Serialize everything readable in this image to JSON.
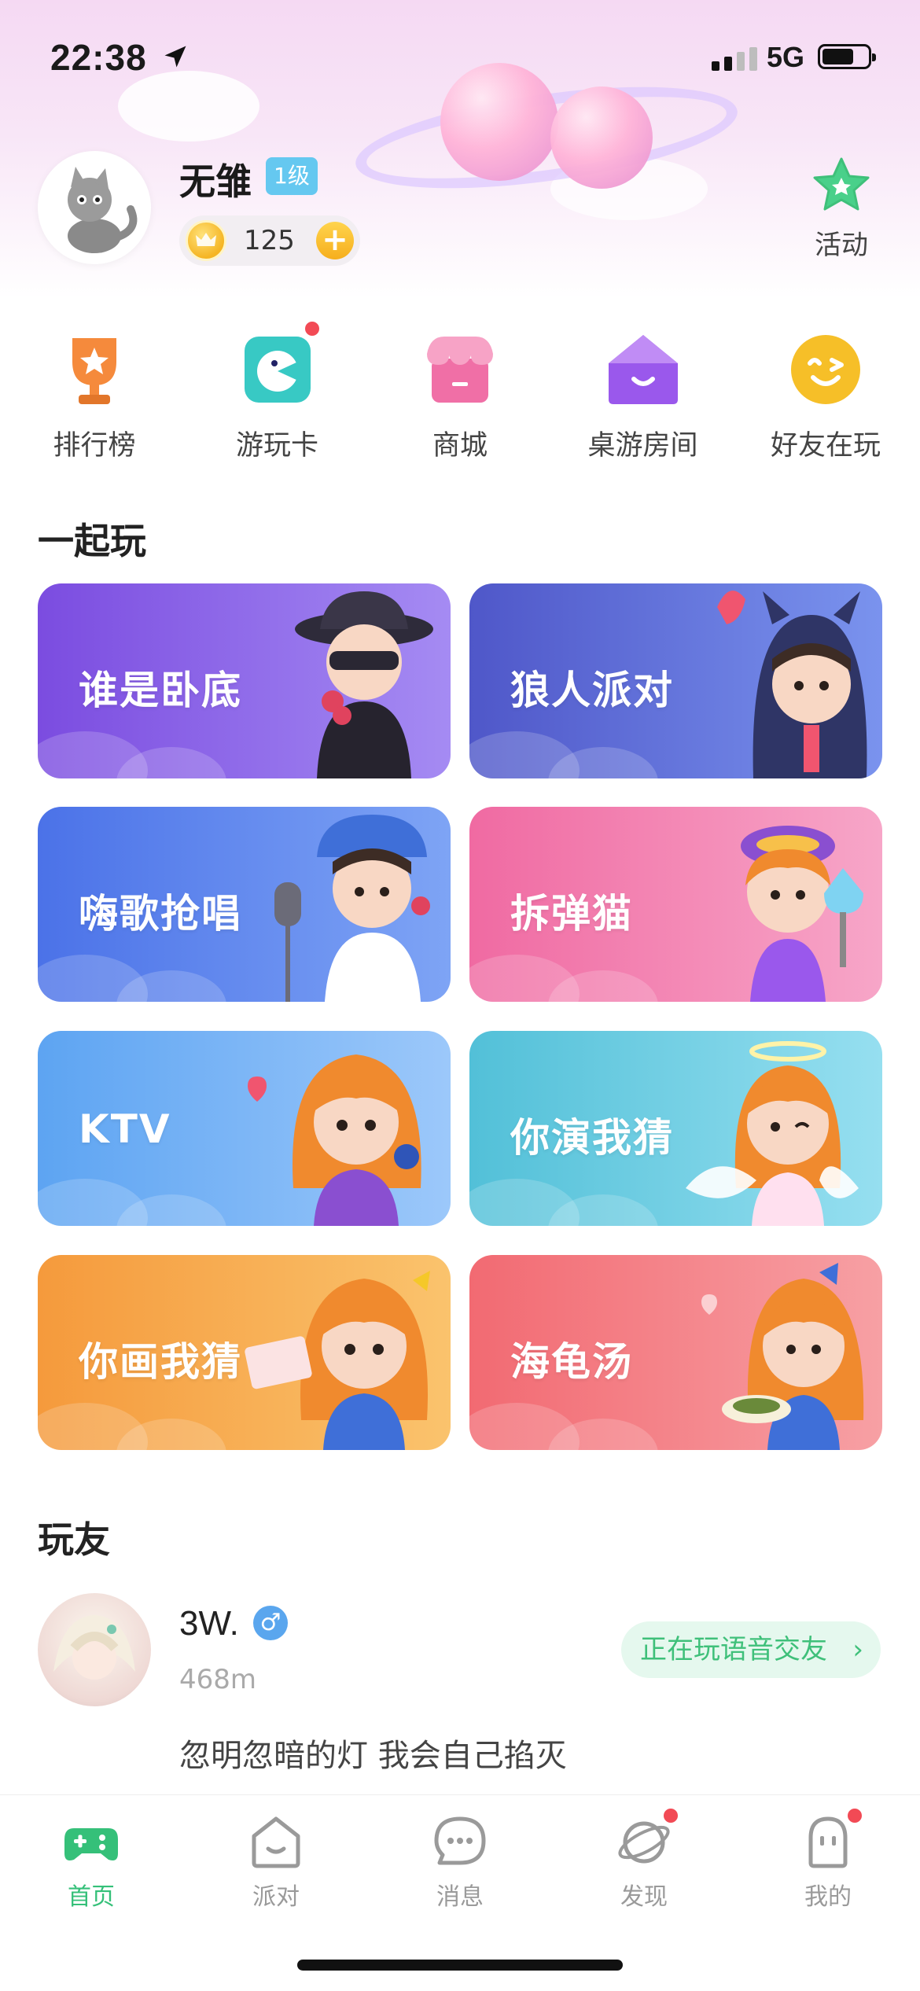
{
  "status_bar": {
    "time": "22:38",
    "network": "5G"
  },
  "profile": {
    "name": "无雏",
    "level": "1级",
    "coins": "125",
    "add_coin_symbol": "+",
    "activity_label": "活动"
  },
  "quick_menu": [
    {
      "label": "排行榜",
      "icon": "trophy-icon",
      "color": "#f58a3c"
    },
    {
      "label": "游玩卡",
      "icon": "play-card-icon",
      "color": "#38c9c4"
    },
    {
      "label": "商城",
      "icon": "shop-icon",
      "color": "#f06fa6"
    },
    {
      "label": "桌游房间",
      "icon": "board-room-icon",
      "color": "#9a58ec"
    },
    {
      "label": "好友在玩",
      "icon": "friends-playing-icon",
      "color": "#f6bf28"
    }
  ],
  "play_together": {
    "title": "一起玩",
    "games": [
      {
        "label": "谁是卧底",
        "color_start": "#7b4ce0",
        "color_end": "#a58bf3"
      },
      {
        "label": "狼人派对",
        "color_start": "#4f57c9",
        "color_end": "#7a93ee"
      },
      {
        "label": "嗨歌抢唱",
        "color_start": "#4b72e8",
        "color_end": "#7ea4f5"
      },
      {
        "label": "拆弹猫",
        "color_start": "#f06aa2",
        "color_end": "#f7a6c8"
      },
      {
        "label": "KTV",
        "color_start": "#5da4f2",
        "color_end": "#9cc8fa"
      },
      {
        "label": "你演我猜",
        "color_start": "#52c0d8",
        "color_end": "#96dff0"
      },
      {
        "label": "你画我猜",
        "color_start": "#f59a3c",
        "color_end": "#fac36d"
      },
      {
        "label": "海龟汤",
        "color_start": "#f26a72",
        "color_end": "#f7a0a4"
      }
    ]
  },
  "friends": {
    "title": "玩友",
    "items": [
      {
        "name": "3W.",
        "gender_symbol": "♂",
        "distance": "468m",
        "status": "正在玩语音交友",
        "status_chevron": "›",
        "bio": "忽明忽暗的灯 我会自己掐灭"
      }
    ]
  },
  "bottom_nav": [
    {
      "label": "首页",
      "icon": "gamepad-icon",
      "active": true
    },
    {
      "label": "派对",
      "icon": "party-icon",
      "active": false
    },
    {
      "label": "消息",
      "icon": "message-icon",
      "active": false
    },
    {
      "label": "发现",
      "icon": "planet-icon",
      "active": false
    },
    {
      "label": "我的",
      "icon": "profile-icon",
      "active": false
    }
  ],
  "colors": {
    "accent_green": "#35c079",
    "badge_red": "#f24a55",
    "level_blue": "#65c8f0"
  }
}
